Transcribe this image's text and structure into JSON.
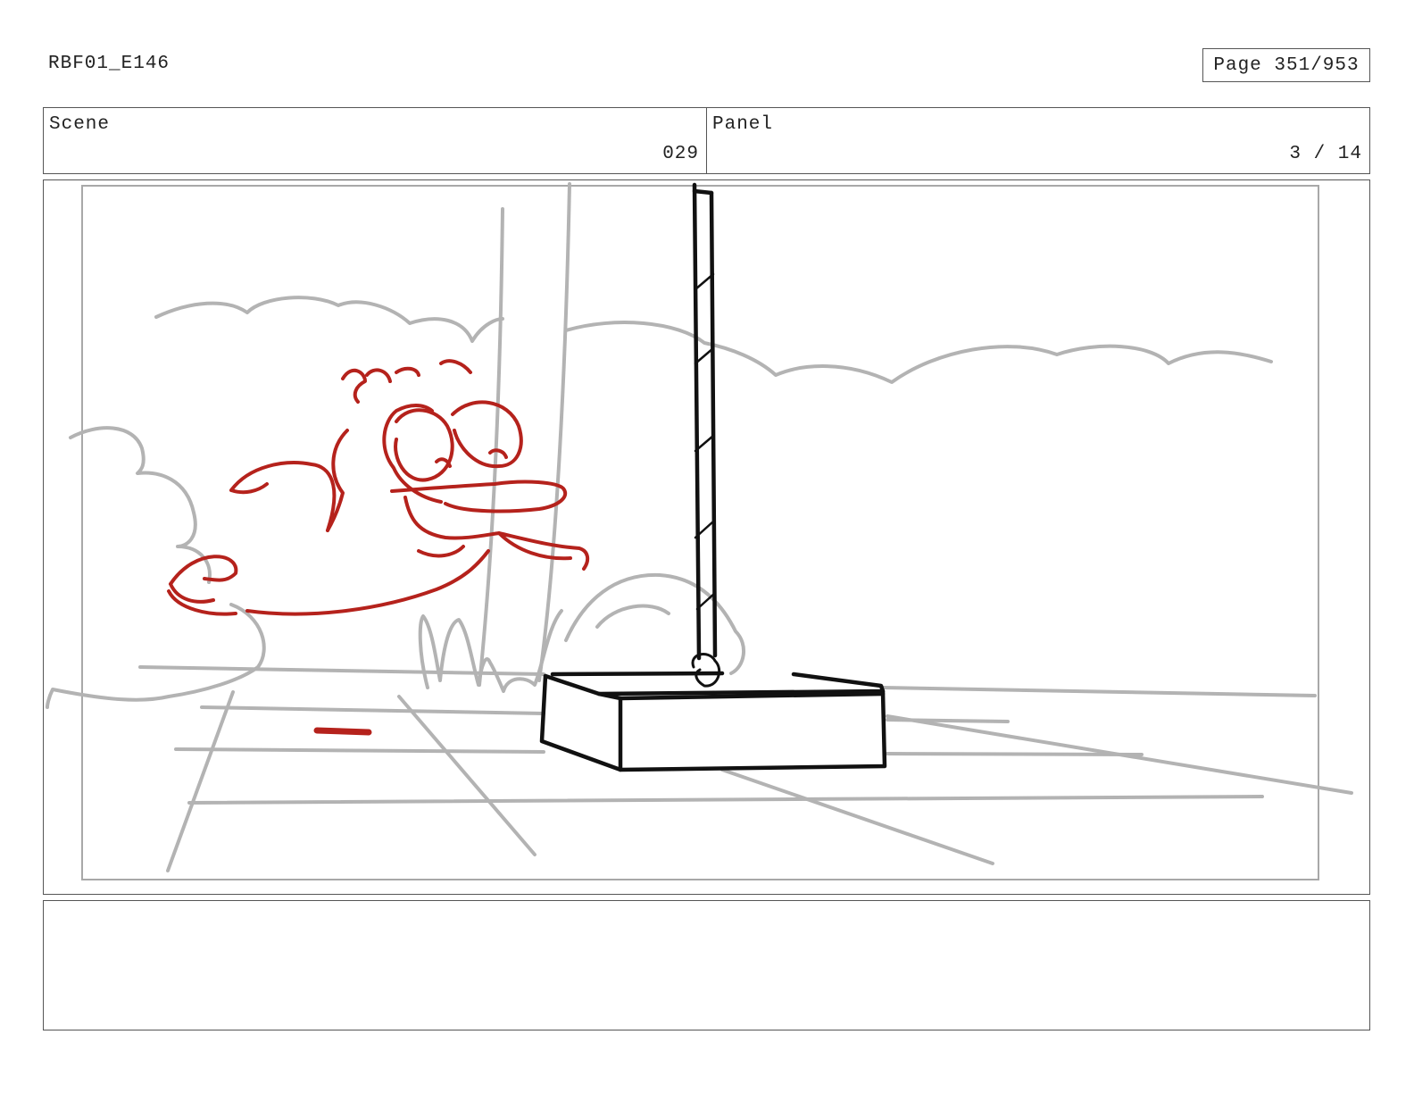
{
  "header": {
    "production_id": "RBF01_E146",
    "page_label": "Page 351/953"
  },
  "info": {
    "scene_label": "Scene",
    "scene_value": "029",
    "panel_label": "Panel",
    "panel_value": "3 / 14"
  },
  "notes": {
    "text": ""
  },
  "colors": {
    "character_line": "#b5221c",
    "background_line": "#b3b3b3",
    "prop_line": "#111111"
  }
}
